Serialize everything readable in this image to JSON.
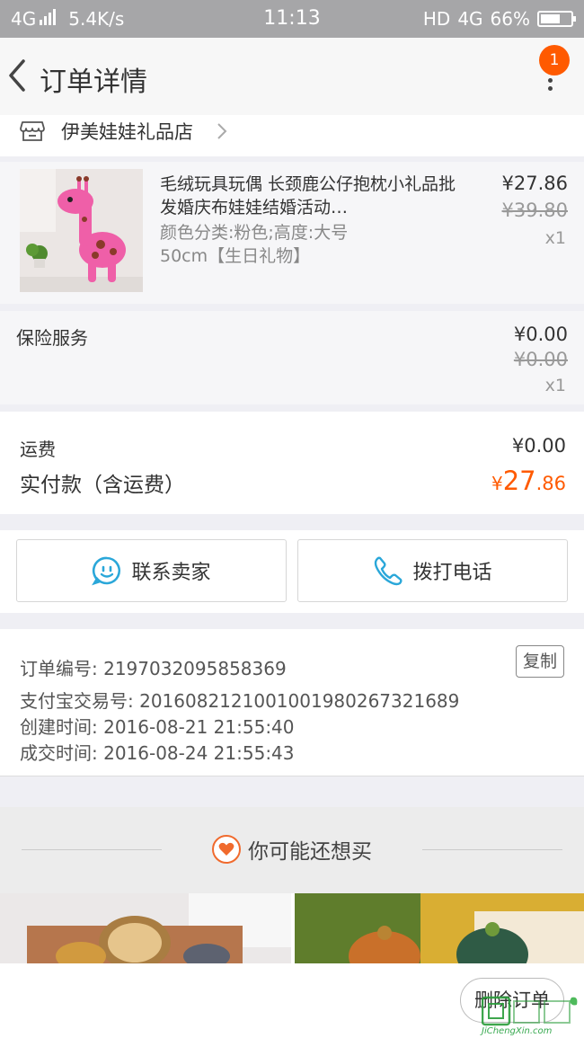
{
  "status_bar": {
    "network": "4G",
    "speed": "5.4K/s",
    "time": "11:13",
    "hd_label": "HD",
    "network_right": "4G",
    "battery": "66%",
    "battery_level": 0.66
  },
  "nav": {
    "title": "订单详情",
    "badge_count": "1"
  },
  "shop": {
    "name": "伊美娃娃礼品店"
  },
  "product": {
    "name": "毛绒玩具玩偶 长颈鹿公仔抱枕小礼品批发婚庆布娃娃结婚活动…",
    "sku": "颜色分类:粉色;高度:大号50cm【生日礼物】",
    "price": "¥27.86",
    "original_price": "¥39.80",
    "quantity": "x1"
  },
  "insurance": {
    "label": "保险服务",
    "price": "¥0.00",
    "original_price": "¥0.00",
    "quantity": "x1"
  },
  "totals": {
    "shipping_label": "运费",
    "shipping_value": "¥0.00",
    "paid_label": "实付款（含运费）",
    "paid_currency": "¥",
    "paid_int": "27",
    "paid_dec": ".86"
  },
  "actions": {
    "contact_label": "联系卖家",
    "call_label": "拨打电话"
  },
  "order_info": {
    "order_no": "订单编号: 2197032095858369",
    "alipay_no": "支付宝交易号: 2016082121001001980267321689",
    "created": "创建时间: 2016-08-21 21:55:40",
    "completed": "成交时间: 2016-08-24 21:55:43",
    "copy_label": "复制"
  },
  "recommend": {
    "heading": "你可能还想买"
  },
  "bottom": {
    "delete_label": "删除订单"
  },
  "watermark": {
    "text": "JiChengXin.com"
  },
  "colors": {
    "accent": "#ff5a00",
    "contact_icon": "#2aa7d9",
    "heart": "#f06a2d"
  }
}
